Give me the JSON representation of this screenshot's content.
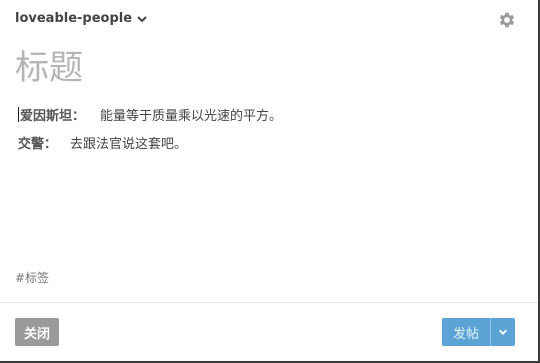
{
  "header": {
    "blog_name": "loveable-people",
    "chevron_icon": "chevron-down-icon",
    "settings_icon": "gear-icon"
  },
  "post": {
    "title_placeholder": "标题",
    "lines": [
      {
        "speaker": "爱因斯坦：",
        "text": "能量等于质量乘以光速的平方。"
      },
      {
        "speaker": "交警：",
        "text": "去跟法官说这套吧。"
      }
    ],
    "tags_placeholder": "#标签"
  },
  "footer": {
    "close_label": "关闭",
    "post_label": "发帖",
    "dropdown_icon": "chevron-down-icon"
  },
  "colors": {
    "post_button": "#5aa3d4",
    "close_button": "#9a9a9a"
  }
}
